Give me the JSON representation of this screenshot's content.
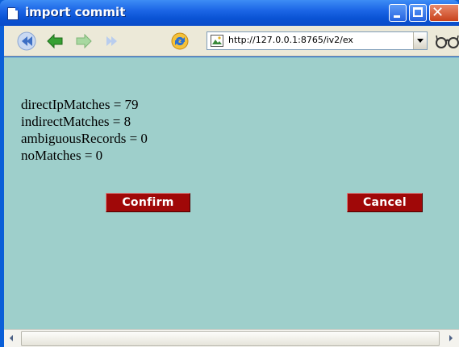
{
  "window": {
    "title": "import commit",
    "controls": [
      "minimize",
      "maximize",
      "close"
    ]
  },
  "toolbar": {
    "buttons": [
      {
        "name": "rewind-icon"
      },
      {
        "name": "back-icon"
      },
      {
        "name": "forward-icon"
      },
      {
        "name": "fast-forward-icon"
      },
      {
        "name": "reload-icon"
      }
    ],
    "url": "http://127.0.0.1:8765/iv2/ex",
    "glasses_icon": "view-glasses-icon"
  },
  "results": {
    "line1": "directIpMatches = 79",
    "line2": "indirectMatches = 8",
    "line3": "ambiguousRecords = 0",
    "line4": "noMatches = 0"
  },
  "actions": {
    "confirm_label": "Confirm",
    "cancel_label": "Cancel"
  },
  "colors": {
    "content_bg": "#9ecfcb",
    "button_bg": "#a00808",
    "titlebar": "#1c66e6"
  }
}
